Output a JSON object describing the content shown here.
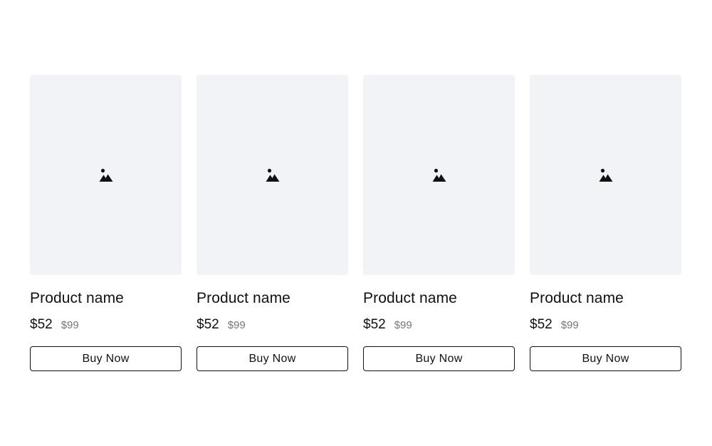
{
  "products": [
    {
      "name": "Product name",
      "price": "$52",
      "old_price": "$99",
      "button_label": "Buy Now",
      "image_icon": "image-placeholder-icon"
    },
    {
      "name": "Product name",
      "price": "$52",
      "old_price": "$99",
      "button_label": "Buy Now",
      "image_icon": "image-placeholder-icon"
    },
    {
      "name": "Product name",
      "price": "$52",
      "old_price": "$99",
      "button_label": "Buy Now",
      "image_icon": "image-placeholder-icon"
    },
    {
      "name": "Product name",
      "price": "$52",
      "old_price": "$99",
      "button_label": "Buy Now",
      "image_icon": "image-placeholder-icon"
    }
  ],
  "colors": {
    "image_background": "#f2f3f6",
    "text": "#111111",
    "muted_text": "#767676",
    "button_border": "#111111"
  }
}
